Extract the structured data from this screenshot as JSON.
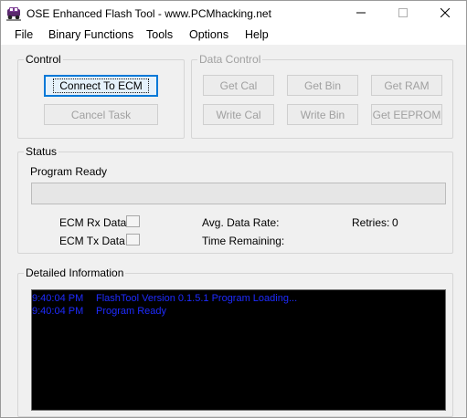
{
  "window": {
    "title": "OSE Enhanced Flash Tool - www.PCMhacking.net"
  },
  "menu": {
    "items": [
      "File",
      "Binary Functions",
      "Tools",
      "Options",
      "Help"
    ]
  },
  "control": {
    "title": "Control",
    "connect_label": "Connect To ECM",
    "cancel_label": "Cancel Task"
  },
  "data_control": {
    "title": "Data Control",
    "buttons": [
      "Get Cal",
      "Get Bin",
      "Get RAM",
      "Write Cal",
      "Write Bin",
      "Get EEPROM"
    ]
  },
  "status": {
    "title": "Status",
    "message": "Program Ready",
    "progress_fraction": 0,
    "ecm_rx_label": "ECM Rx Data",
    "ecm_tx_label": "ECM Tx Data",
    "avg_rate_label": "Avg. Data Rate:",
    "time_remaining_label": "Time Remaining:",
    "retries_label": "Retries:",
    "retries_value": "0"
  },
  "detailed": {
    "title": "Detailed Information",
    "log": [
      {
        "time": "9:40:04 PM",
        "message": "FlashTool Version 0.1.5.1 Program Loading..."
      },
      {
        "time": "9:40:04 PM",
        "message": "Program Ready"
      }
    ]
  },
  "colors": {
    "log_text": "#1e2bff",
    "log_background": "#000000",
    "focus_accent": "#0078d7"
  }
}
